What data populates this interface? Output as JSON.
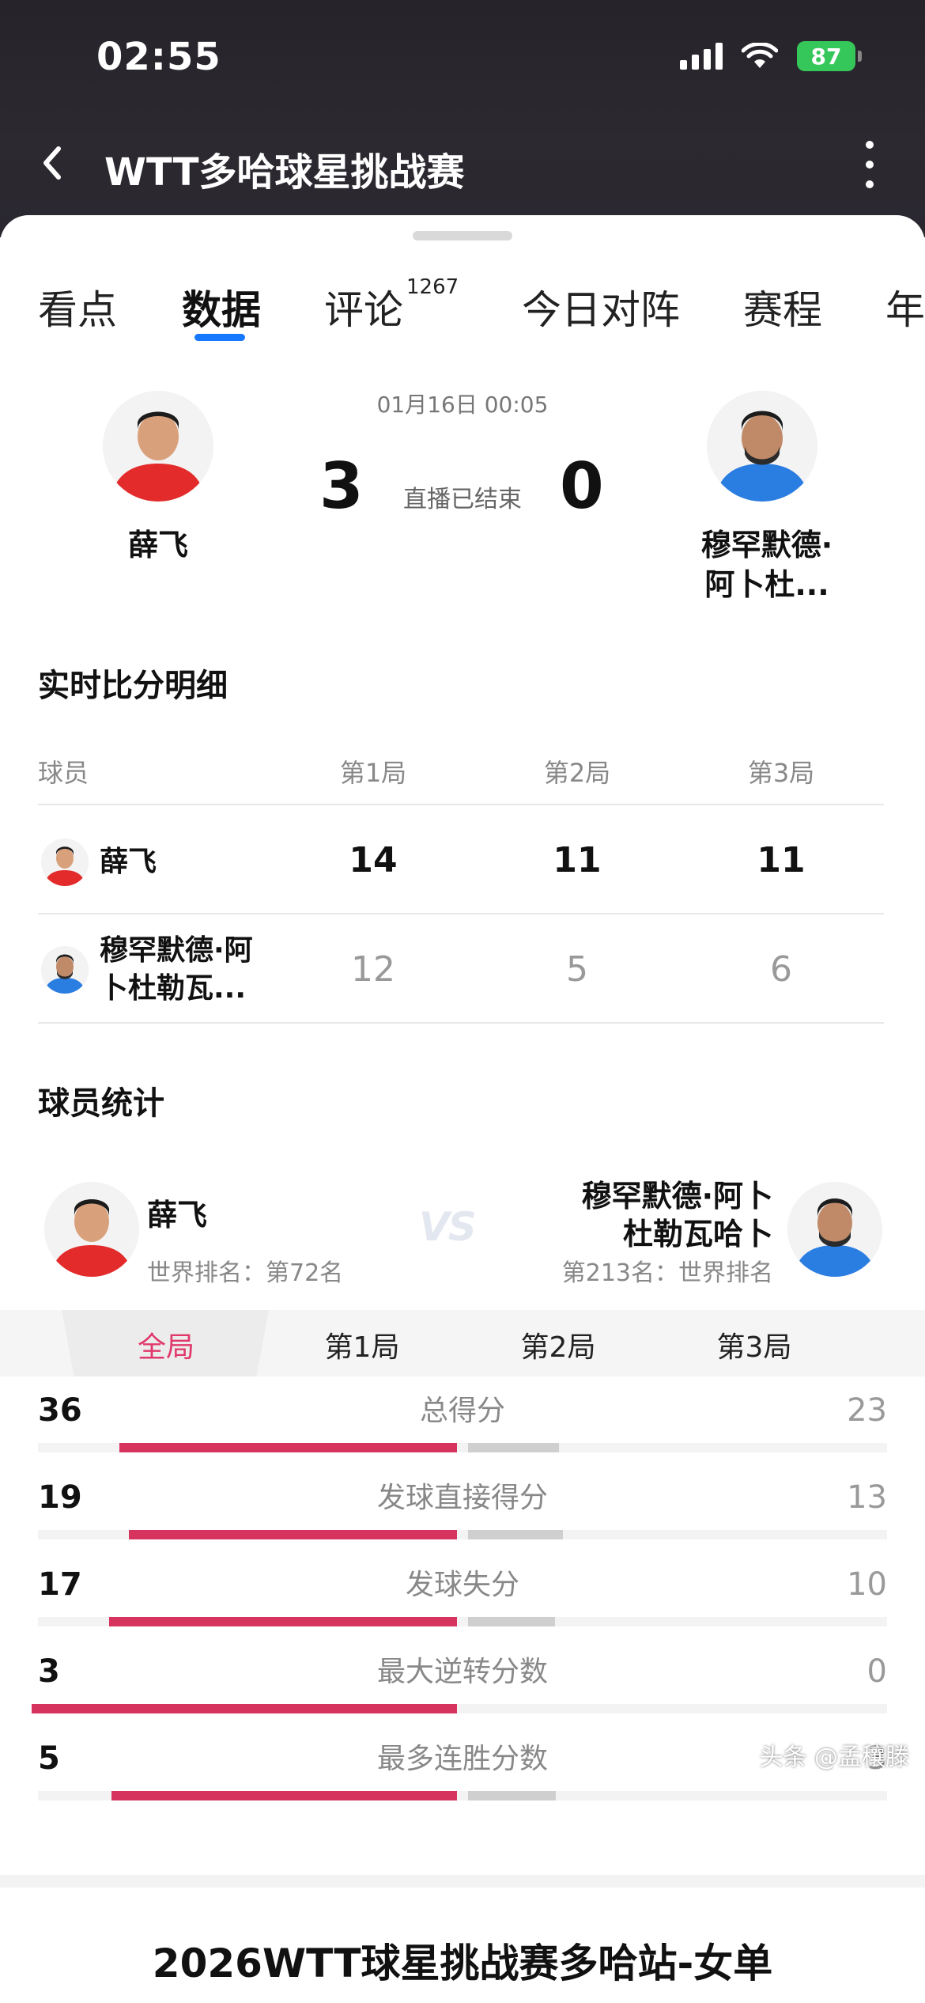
{
  "status_bar": {
    "time": "02:55",
    "battery": "87"
  },
  "nav": {
    "title": "WTT多哈球星挑战赛"
  },
  "tabs": [
    {
      "label": "看点"
    },
    {
      "label": "数据"
    },
    {
      "label": "评论",
      "count": "1267"
    },
    {
      "label": "今日对阵"
    },
    {
      "label": "赛程"
    },
    {
      "label": "年"
    }
  ],
  "match": {
    "date": "01月16日 00:05",
    "status": "直播已结束",
    "home": {
      "name": "薛飞",
      "score": "3"
    },
    "away": {
      "name_line1": "穆罕默德·",
      "name_line2": "阿卜杜...",
      "score": "0"
    }
  },
  "score_detail": {
    "title": "实时比分明细",
    "headers": [
      "球员",
      "第1局",
      "第2局",
      "第3局"
    ],
    "rows": [
      {
        "name": "薛飞",
        "scores": [
          "14",
          "11",
          "11"
        ]
      },
      {
        "name_line1": "穆罕默德·阿",
        "name_line2": "卜杜勒瓦...",
        "scores": [
          "12",
          "5",
          "6"
        ]
      }
    ]
  },
  "player_stats": {
    "title": "球员统计",
    "home": {
      "name": "薛飞",
      "rank": "世界排名：第72名"
    },
    "away": {
      "name_line1": "穆罕默德·阿卜",
      "name_line2": "杜勒瓦哈卜",
      "rank": "第213名：世界排名"
    },
    "vs": "VS",
    "periods": [
      "全局",
      "第1局",
      "第2局",
      "第3局"
    ],
    "accent_color": "#d6335f",
    "rows": [
      {
        "label": "总得分",
        "home": "36",
        "away": "23"
      },
      {
        "label": "发球直接得分",
        "home": "19",
        "away": "13"
      },
      {
        "label": "发球失分",
        "home": "17",
        "away": "10"
      },
      {
        "label": "最大逆转分数",
        "home": "3",
        "away": "0"
      },
      {
        "label": "最多连胜分数",
        "home": "5",
        "away": "3"
      }
    ]
  },
  "footer": {
    "title": "2026WTT球星挑战赛多哈站-女单",
    "watermark": "头条 @孟穰滕"
  }
}
